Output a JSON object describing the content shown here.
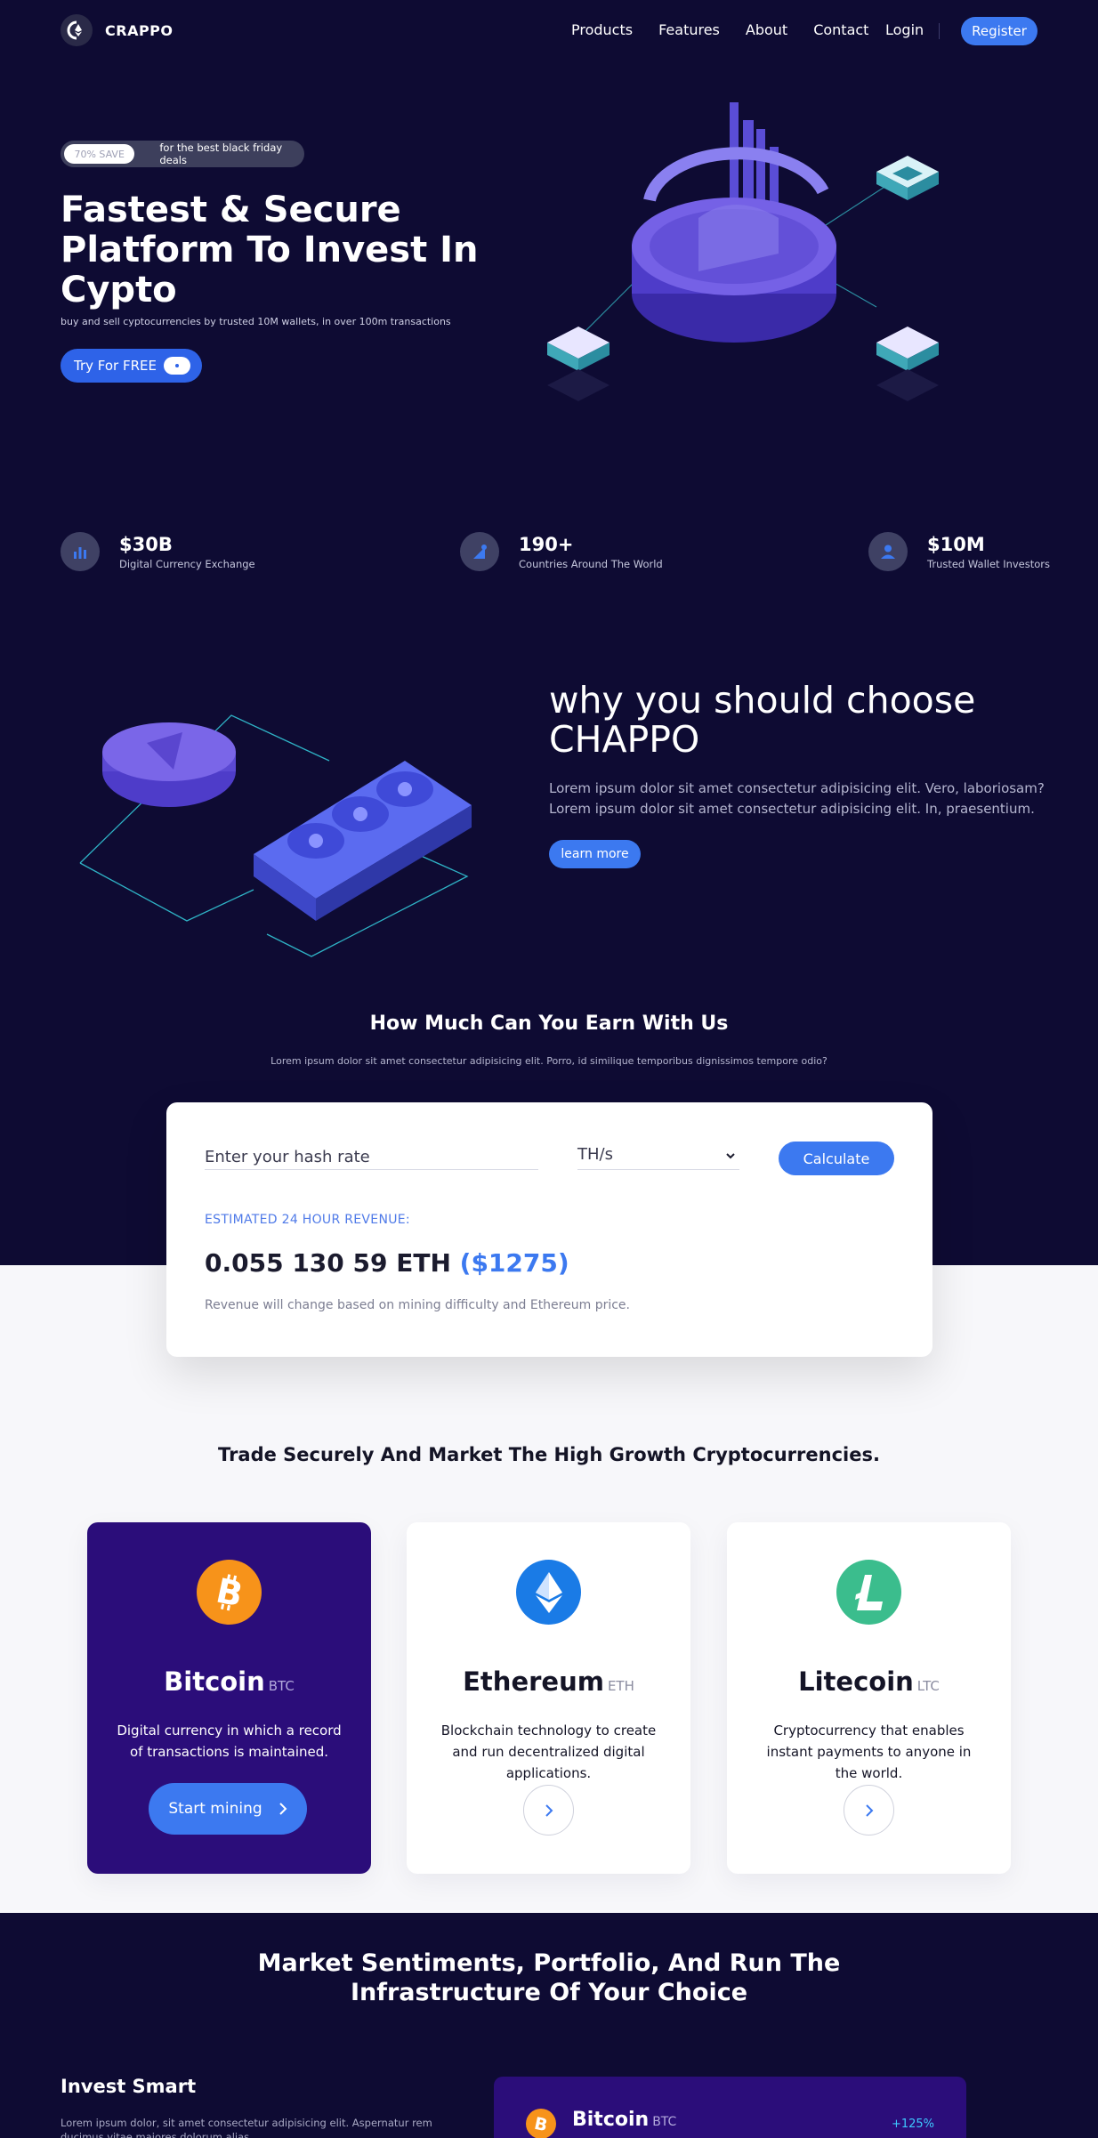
{
  "nav": {
    "brand": "CRAPPO",
    "links": [
      "Products",
      "Features",
      "About",
      "Contact"
    ],
    "login": "Login",
    "register": "Register"
  },
  "hero": {
    "badge_pill": "70% SAVE",
    "badge_text": "for the best black friday deals",
    "title": "Fastest & Secure Platform To Invest In Cypto",
    "subtitle": "buy and sell cyptocurrencies by trusted 10M wallets, in over 100m transactions",
    "cta": "Try For FREE"
  },
  "stats": [
    {
      "value": "$30B",
      "label": "Digital Currency Exchange",
      "icon": "bar-chart-icon"
    },
    {
      "value": "190+",
      "label": "Countries Around The World",
      "icon": "globe-pin-icon"
    },
    {
      "value": "$10M",
      "label": "Trusted Wallet Investors",
      "icon": "user-icon"
    }
  ],
  "why": {
    "title_line1": "why you should choose",
    "title_line2": "CHAPPO",
    "text": "Lorem ipsum dolor sit amet consectetur adipisicing elit. Vero, laboriosam? Lorem ipsum dolor sit amet consectetur adipisicing elit. In, praesentium.",
    "cta": "learn more"
  },
  "earn": {
    "title": "How Much Can You Earn With Us",
    "subtitle": "Lorem ipsum dolor sit amet consectetur adipisicing elit. Porro, id similique temporibus dignissimos tempore odio?",
    "input_placeholder": "Enter your hash rate",
    "unit": "TH/s",
    "calculate": "Calculate",
    "estimate_label": "ESTIMATED 24 HOUR REVENUE:",
    "estimate_eth": "0.055 130 59 ETH",
    "estimate_usd": "($1275)",
    "note": "Revenue will change based on mining difficulty and Ethereum price."
  },
  "trade": {
    "title": "Trade Securely And Market The High Growth Cryptocurrencies.",
    "coins": [
      {
        "name": "Bitcoin",
        "symbol": "BTC",
        "desc": "Digital currency in which a record of transactions is maintained.",
        "cta": "Start mining",
        "color": "#f7931a",
        "icon": "bitcoin-icon"
      },
      {
        "name": "Ethereum",
        "symbol": "ETH",
        "desc": "Blockchain technology to create and run decentralized digital applications.",
        "color": "#1a7be6",
        "icon": "ethereum-icon"
      },
      {
        "name": "Litecoin",
        "symbol": "LTC",
        "desc": "Cryptocurrency that enables instant payments to anyone in the world.",
        "color": "#3bbd8d",
        "icon": "litecoin-icon"
      }
    ]
  },
  "market": {
    "title_line1": "Market Sentiments, Portfolio, And Run The",
    "title_line2": "Infrastructure Of Your Choice",
    "invest_title": "Invest Smart",
    "invest_text": "Lorem ipsum dolor, sit amet consectetur adipisicing elit. Aspernatur rem ducimus vitae maiores dolorum alias.",
    "card_name": "Bitcoin",
    "card_symbol": "BTC",
    "card_change": "+125%"
  },
  "colors": {
    "page_bg": "#0e0b33",
    "accent": "#3c79f0",
    "card_active": "#2b0d7a",
    "light_bg": "#f7f7fa"
  }
}
